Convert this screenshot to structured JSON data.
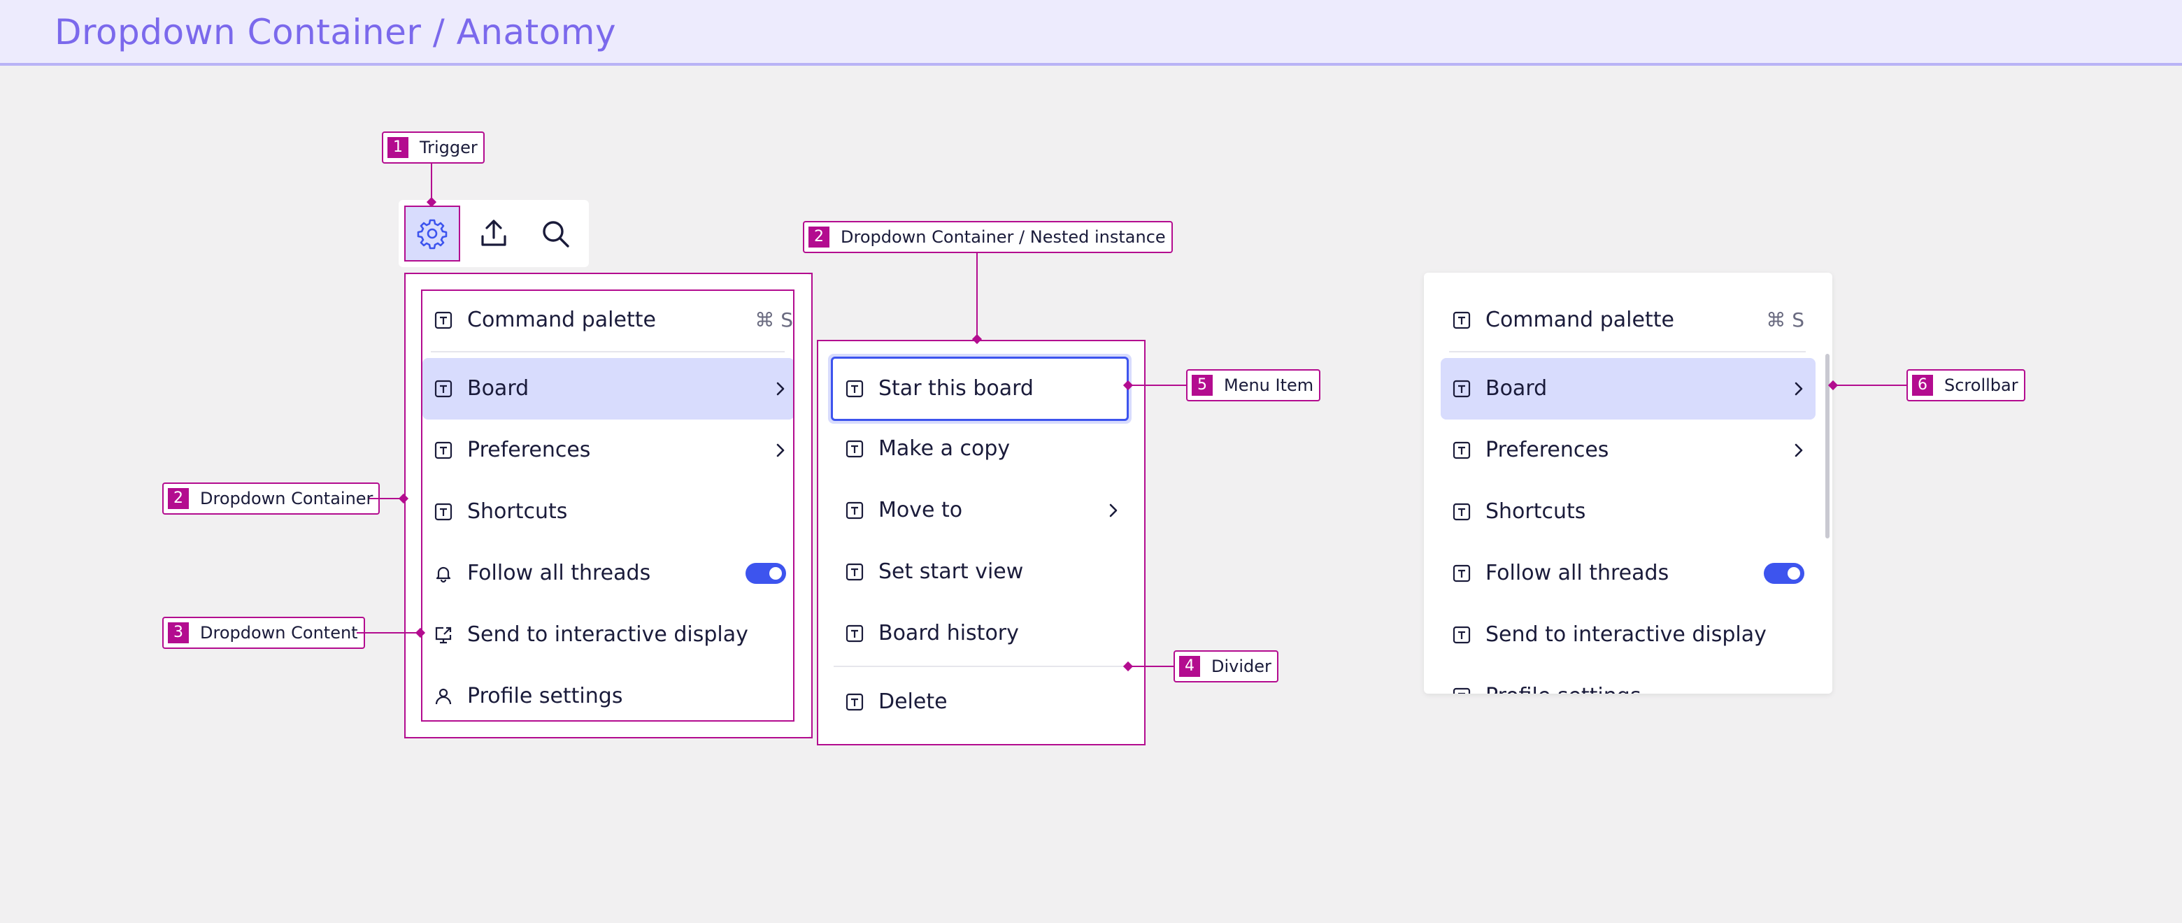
{
  "header": {
    "title": "Dropdown Container / Anatomy"
  },
  "colors": {
    "accent": "#b30c8f",
    "highlight": "#d8dcfd",
    "toggle": "#3d54ee",
    "title": "#7b69ec"
  },
  "toolbar": {
    "icons": [
      "gear-icon",
      "upload-icon",
      "search-icon"
    ]
  },
  "main_menu": {
    "items": [
      {
        "label": "Command palette",
        "shortcut": "⌘ S",
        "icon": "text-box-icon"
      },
      {
        "label": "Board",
        "icon": "text-box-icon",
        "submenu": true,
        "highlighted": true
      },
      {
        "label": "Preferences",
        "icon": "text-box-icon",
        "submenu": true
      },
      {
        "label": "Shortcuts",
        "icon": "text-box-icon"
      },
      {
        "label": "Follow all threads",
        "icon": "bell-icon",
        "toggle": true
      },
      {
        "label": "Send to interactive display",
        "icon": "external-display-icon"
      },
      {
        "label": "Profile settings",
        "icon": "user-icon"
      }
    ]
  },
  "nested_menu": {
    "items": [
      {
        "label": "Star this board",
        "focused": true
      },
      {
        "label": "Make a copy"
      },
      {
        "label": "Move to",
        "submenu": true
      },
      {
        "label": "Set start view"
      },
      {
        "label": "Board history"
      },
      {
        "label": "Delete"
      }
    ]
  },
  "scroll_menu": {
    "items": [
      {
        "label": "Command palette",
        "shortcut": "⌘ S"
      },
      {
        "label": "Board",
        "submenu": true,
        "highlighted": true
      },
      {
        "label": "Preferences",
        "submenu": true
      },
      {
        "label": "Shortcuts"
      },
      {
        "label": "Follow all threads",
        "toggle": true
      },
      {
        "label": "Send to interactive display"
      },
      {
        "label": "Profile settings"
      }
    ]
  },
  "annotations": {
    "trigger": {
      "num": "1",
      "text": "Trigger"
    },
    "nested": {
      "num": "2",
      "text": "Dropdown Container / Nested instance"
    },
    "container": {
      "num": "2",
      "text": "Dropdown Container"
    },
    "content": {
      "num": "3",
      "text": "Dropdown Content"
    },
    "menu_item": {
      "num": "5",
      "text": "Menu Item"
    },
    "divider": {
      "num": "4",
      "text": "Divider"
    },
    "scrollbar": {
      "num": "6",
      "text": "Scrollbar"
    }
  }
}
